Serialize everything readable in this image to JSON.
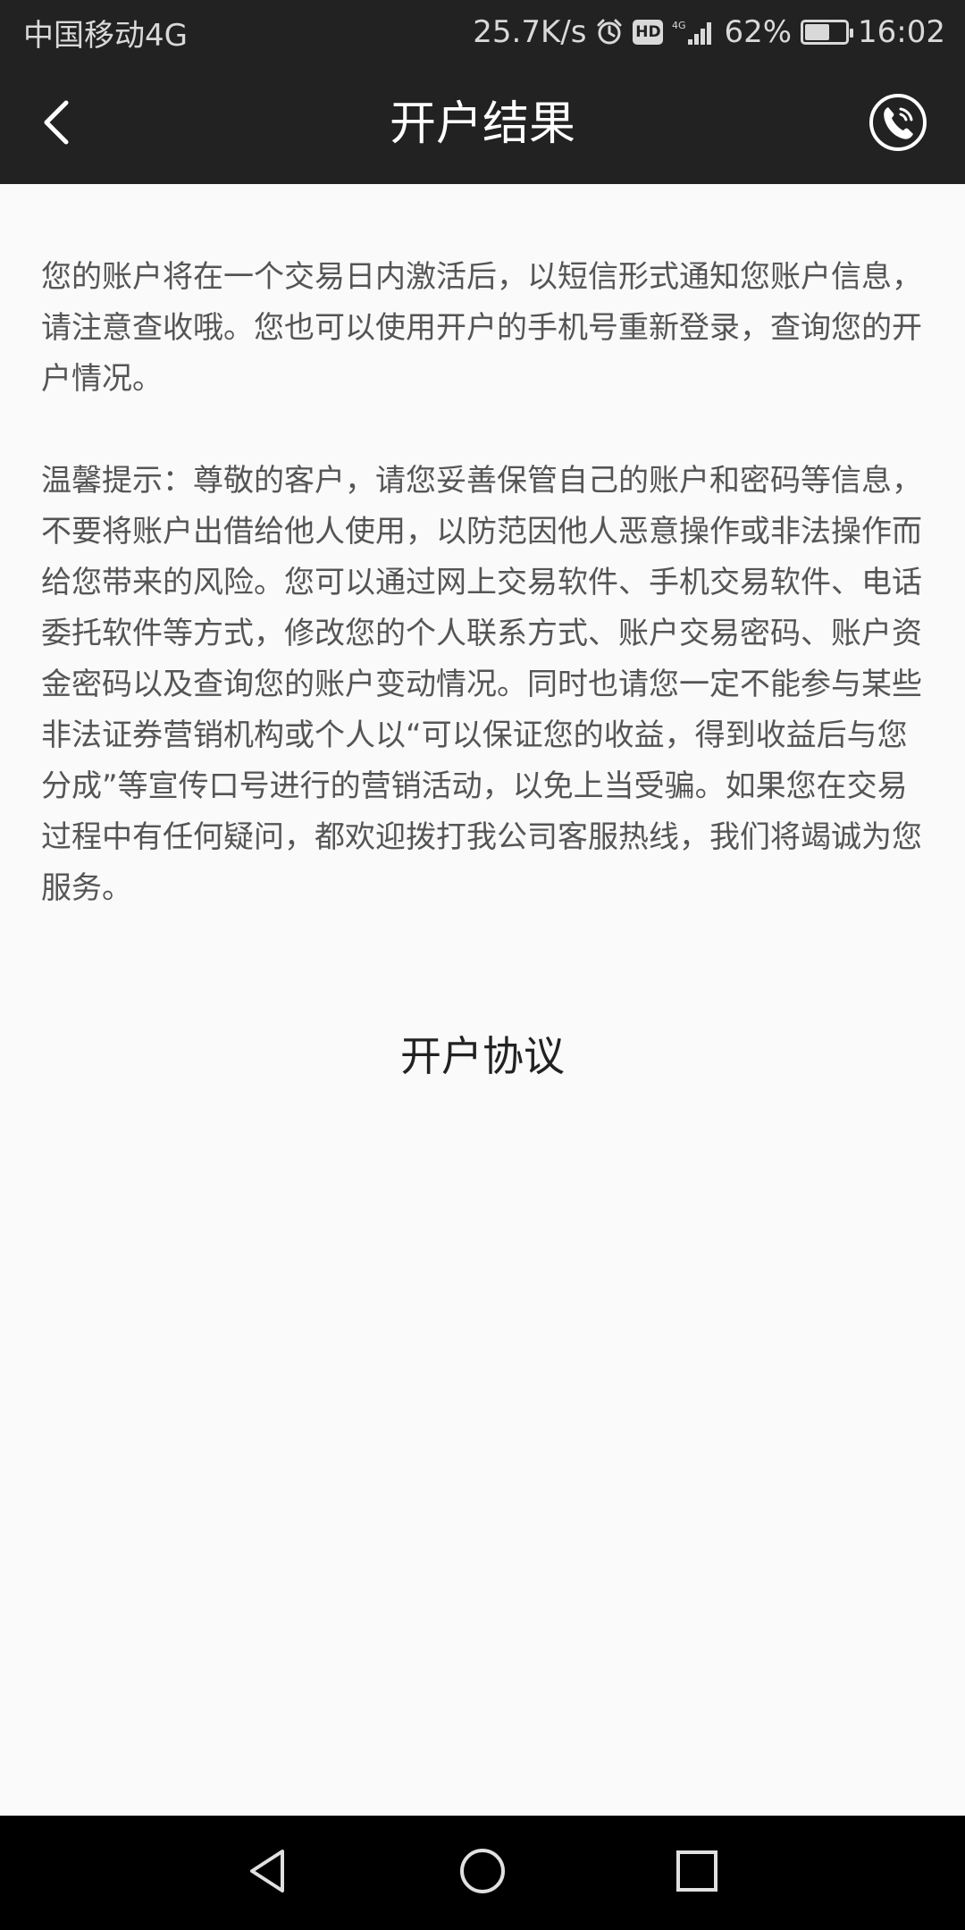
{
  "status_bar": {
    "carrier": "中国移动4G",
    "speed": "25.7K/s",
    "hd_label": "HD",
    "network_label": "4G",
    "battery_percent": "62%",
    "battery_level": 0.62,
    "time": "16:02",
    "icons": [
      "alarm-icon",
      "hd-icon",
      "signal-icon",
      "battery-icon"
    ]
  },
  "header": {
    "title": "开户结果",
    "back_icon": "chevron-left-icon",
    "phone_icon": "phone-icon"
  },
  "main": {
    "paragraph1": "您的账户将在一个交易日内激活后，以短信形式通知您账户信息，请注意查收哦。您也可以使用开户的手机号重新登录，查询您的开户情况。",
    "paragraph2": "温馨提示：尊敬的客户，请您妥善保管自己的账户和密码等信息，不要将账户出借给他人使用，以防范因他人恶意操作或非法操作而给您带来的风险。您可以通过网上交易软件、手机交易软件、电话委托软件等方式，修改您的个人联系方式、账户交易密码、账户资金密码以及查询您的账户变动情况。同时也请您一定不能参与某些非法证券营销机构或个人以“可以保证您的收益，得到收益后与您分成”等宣传口号进行的营销活动，以免上当受骗。如果您在交易过程中有任何疑问，都欢迎拨打我公司客服热线，我们将竭诚为您服务。",
    "agreement_link": "开户协议"
  },
  "nav_bar": {
    "icons": [
      "back-triangle-icon",
      "home-circle-icon",
      "recent-square-icon"
    ]
  },
  "colors": {
    "bar_background": "#222222",
    "content_background": "#fafafa",
    "body_text": "#555555",
    "nav_background": "#000000"
  }
}
